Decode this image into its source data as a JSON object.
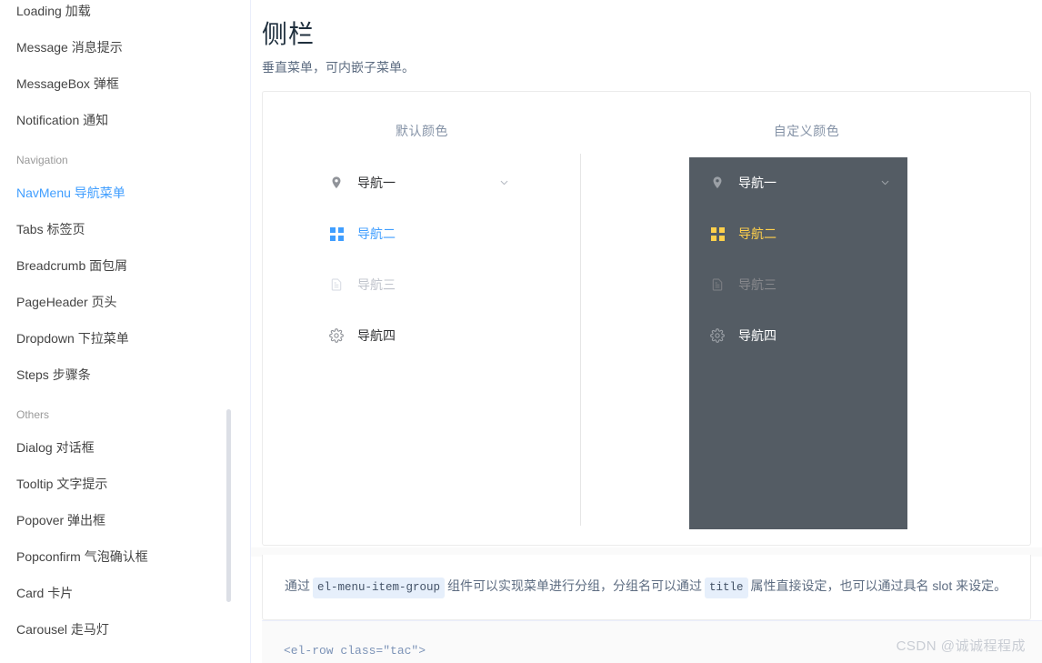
{
  "sidebar": {
    "items": [
      {
        "label": "Loading 加载",
        "type": "item",
        "active": false
      },
      {
        "label": "Message 消息提示",
        "type": "item",
        "active": false
      },
      {
        "label": "MessageBox 弹框",
        "type": "item",
        "active": false
      },
      {
        "label": "Notification 通知",
        "type": "item",
        "active": false
      },
      {
        "label": "Navigation",
        "type": "group",
        "active": false
      },
      {
        "label": "NavMenu 导航菜单",
        "type": "item",
        "active": true
      },
      {
        "label": "Tabs 标签页",
        "type": "item",
        "active": false
      },
      {
        "label": "Breadcrumb 面包屑",
        "type": "item",
        "active": false
      },
      {
        "label": "PageHeader 页头",
        "type": "item",
        "active": false
      },
      {
        "label": "Dropdown 下拉菜单",
        "type": "item",
        "active": false
      },
      {
        "label": "Steps 步骤条",
        "type": "item",
        "active": false
      },
      {
        "label": "Others",
        "type": "group",
        "active": false
      },
      {
        "label": "Dialog 对话框",
        "type": "item",
        "active": false
      },
      {
        "label": "Tooltip 文字提示",
        "type": "item",
        "active": false
      },
      {
        "label": "Popover 弹出框",
        "type": "item",
        "active": false
      },
      {
        "label": "Popconfirm 气泡确认框",
        "type": "item",
        "active": false
      },
      {
        "label": "Card 卡片",
        "type": "item",
        "active": false
      },
      {
        "label": "Carousel 走马灯",
        "type": "item",
        "active": false
      }
    ]
  },
  "main": {
    "title": "侧栏",
    "description": "垂直菜单，可内嵌子菜单。",
    "columns": [
      {
        "title": "默认颜色",
        "theme": "light"
      },
      {
        "title": "自定义颜色",
        "theme": "dark"
      }
    ],
    "menu_items": [
      {
        "label": "导航一",
        "icon": "location-icon",
        "state": "normal",
        "has_arrow": true
      },
      {
        "label": "导航二",
        "icon": "menu-grid-icon",
        "state": "active",
        "has_arrow": false
      },
      {
        "label": "导航三",
        "icon": "document-icon",
        "state": "disabled",
        "has_arrow": false
      },
      {
        "label": "导航四",
        "icon": "setting-icon",
        "state": "normal",
        "has_arrow": false
      }
    ],
    "note": {
      "part1": "通过",
      "code1": "el-menu-item-group",
      "part2": "组件可以实现菜单进行分组，分组名可以通过",
      "code2": "title",
      "part3": "属性直接设定，也可以通过具名 slot 来设定。"
    },
    "code_line": "<el-row class=\"tac\">"
  },
  "colors": {
    "accent_light": "#409eff",
    "accent_dark": "#ffd04b",
    "dark_bg": "#545c64"
  },
  "watermark": "CSDN @诚诚程程成"
}
